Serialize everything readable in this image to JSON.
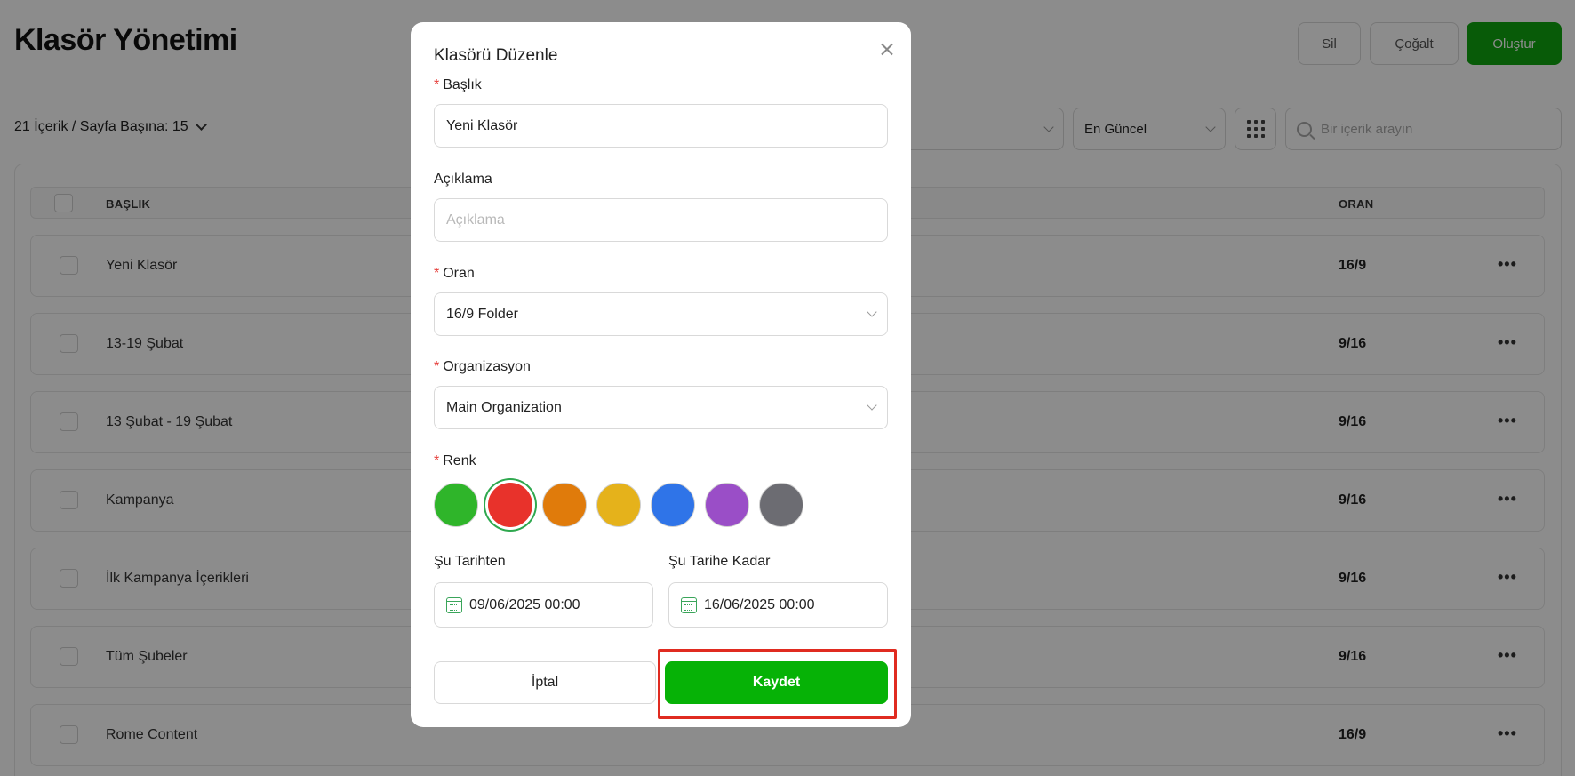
{
  "page": {
    "title": "Klasör Yönetimi",
    "actions": {
      "delete": "Sil",
      "duplicate": "Çoğalt",
      "create": "Oluştur"
    },
    "pagination_summary": "21 İçerik / Sayfa Başına: 15",
    "sort_value": "En Güncel",
    "search_placeholder": "Bir içerik arayın",
    "table": {
      "headers": {
        "title": "BAŞLIK",
        "ratio": "ORAN"
      },
      "more_glyph": "•••",
      "rows": [
        {
          "title": "Yeni Klasör",
          "ratio": "16/9"
        },
        {
          "title": "13-19 Şubat",
          "ratio": "9/16"
        },
        {
          "title": "13 Şubat - 19 Şubat",
          "ratio": "9/16"
        },
        {
          "title": "Kampanya",
          "ratio": "9/16"
        },
        {
          "title": "İlk Kampanya İçerikleri",
          "ratio": "9/16"
        },
        {
          "title": "Tüm Şubeler",
          "ratio": "9/16"
        },
        {
          "title": "Rome Content",
          "ratio": "16/9"
        }
      ]
    }
  },
  "modal": {
    "title": "Klasörü Düzenle",
    "required_mark": "*",
    "title_label": "Başlık",
    "title_value": "Yeni Klasör",
    "description_label": "Açıklama",
    "description_placeholder": "Açıklama",
    "ratio_label": "Oran",
    "ratio_value": "16/9 Folder",
    "organization_label": "Organizasyon",
    "organization_value": "Main Organization",
    "color_label": "Renk",
    "colors": [
      "#2fb52a",
      "#e8322b",
      "#e07b0b",
      "#e5b21b",
      "#2f74e8",
      "#9a4ec7",
      "#6c6c72"
    ],
    "selected_color": "#e8322b",
    "from_label": "Şu Tarihten",
    "from_value": "09/06/2025 00:00",
    "to_label": "Şu Tarihe Kadar",
    "to_value": "16/06/2025 00:00",
    "cancel_label": "İptal",
    "save_label": "Kaydet"
  },
  "colors": {
    "brand_green": "#0fa60f",
    "save_green": "#06b206",
    "highlight_red": "#e02b20",
    "required_red": "#e53935"
  }
}
